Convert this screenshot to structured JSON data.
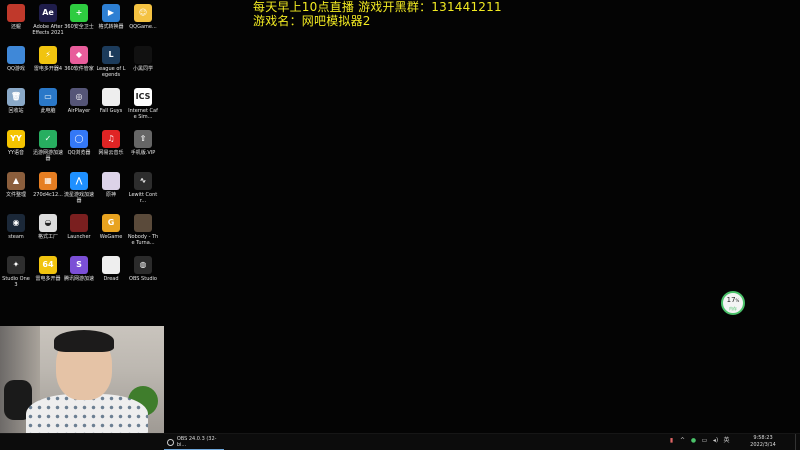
{
  "overlay": {
    "line1": "每天早上10点直播   游戏开黑群：131441211",
    "line2": "游戏名：网吧模拟器2"
  },
  "desktop_icons": [
    {
      "label": "还鲲",
      "color": "#c0392b",
      "glyph": ""
    },
    {
      "label": "Adobe After Effects 2021",
      "color": "#1f1d4a",
      "glyph": "Ae"
    },
    {
      "label": "360安全卫士",
      "color": "#2ecc40",
      "glyph": "+"
    },
    {
      "label": "格式转换器",
      "color": "#2d7fd3",
      "glyph": "▶"
    },
    {
      "label": "QQGame...",
      "color": "#f4c242",
      "glyph": "☺"
    },
    {
      "label": "QQ游戏",
      "color": "#3f88d8",
      "glyph": ""
    },
    {
      "label": "雷电多开器4",
      "color": "#f1c40f",
      "glyph": "⚡"
    },
    {
      "label": "360软件管家",
      "color": "#e85d9b",
      "glyph": "◆"
    },
    {
      "label": "League of Legends",
      "color": "#1c3b5b",
      "glyph": "L"
    },
    {
      "label": "小黑同学",
      "color": "#111111",
      "glyph": ""
    },
    {
      "label": "回收站",
      "color": "#8aa9c8",
      "glyph": "🗑"
    },
    {
      "label": "此电脑",
      "color": "#2a78c8",
      "glyph": "▭"
    },
    {
      "label": "AirPlayer",
      "color": "#555577",
      "glyph": "◎"
    },
    {
      "label": "Fall Guys",
      "color": "#eeeeee",
      "glyph": ""
    },
    {
      "label": "Internet Cafe Sim...",
      "color": "#ffffff",
      "glyph": "ICS"
    },
    {
      "label": "YY语音",
      "color": "#f5c400",
      "glyph": "YY"
    },
    {
      "label": "迅游网游加速器",
      "color": "#27ae60",
      "glyph": "✓"
    },
    {
      "label": "QQ浏览器",
      "color": "#3478f6",
      "glyph": "◯"
    },
    {
      "label": "网易云音乐",
      "color": "#e02424",
      "glyph": "♫"
    },
    {
      "label": "手机版.VIP",
      "color": "#666666",
      "glyph": "⇧"
    },
    {
      "label": "文件整理",
      "color": "#8b5e3c",
      "glyph": "▲"
    },
    {
      "label": "270d4c12...",
      "color": "#e67e22",
      "glyph": "▦"
    },
    {
      "label": "流星游戏加速器",
      "color": "#1e90ff",
      "glyph": "⋀"
    },
    {
      "label": "原神",
      "color": "#dcd3e8",
      "glyph": ""
    },
    {
      "label": "Lewitt Contr...",
      "color": "#2d2d2d",
      "glyph": "∿"
    },
    {
      "label": "steam",
      "color": "#1b2838",
      "glyph": "◉"
    },
    {
      "label": "格式工厂",
      "color": "#dddddd",
      "glyph": "◒"
    },
    {
      "label": "Launcher",
      "color": "#7a1f1f",
      "glyph": ""
    },
    {
      "label": "WeGame",
      "color": "#e8a320",
      "glyph": "G"
    },
    {
      "label": "Nobody - The Turna...",
      "color": "#5a4a3a",
      "glyph": ""
    },
    {
      "label": "Studio One 3",
      "color": "#2e2e2e",
      "glyph": "✦"
    },
    {
      "label": "雷电多开器",
      "color": "#f1c40f",
      "glyph": "64"
    },
    {
      "label": "腾讯网游加速",
      "color": "#7b4fd6",
      "glyph": "S"
    },
    {
      "label": "Dread",
      "color": "#eeeeee",
      "glyph": ""
    },
    {
      "label": "OBS Studio",
      "color": "#2b2b2b",
      "glyph": "◍"
    }
  ],
  "widget": {
    "value": "17",
    "unit": "%",
    "sub": "内存"
  },
  "taskbar": {
    "app_label": "OBS 24.0.3 (32-bi...",
    "tray_icons": [
      "flag-icon",
      "chevron-up-icon",
      "wechat-icon",
      "network-icon",
      "speaker-icon",
      "ime-icon"
    ],
    "tray_glyphs": [
      "▮",
      "^",
      "●",
      "▭",
      "◂)",
      "英"
    ],
    "time": "9:58:23",
    "date": "2022/3/14"
  }
}
